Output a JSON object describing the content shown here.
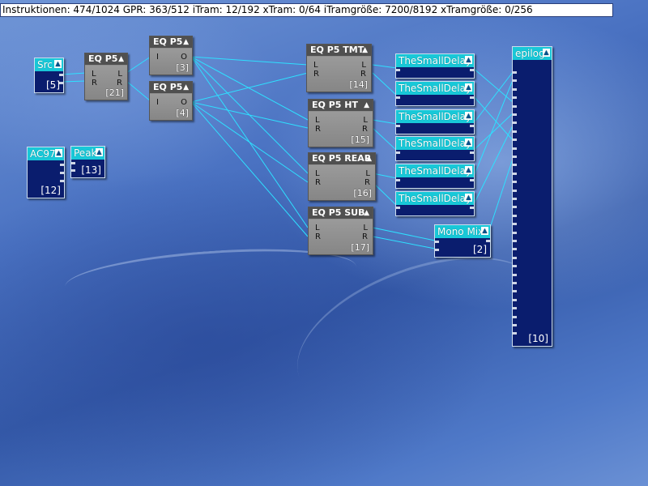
{
  "status_bar": "Instruktionen: 474/1024 GPR: 363/512 iTram: 12/192 xTram: 0/64 iTramgröße: 7200/8192 xTramgröße: 0/256",
  "arrow": "▲",
  "blocks": {
    "src": {
      "title": "Src",
      "index": "[5]"
    },
    "ac97": {
      "title": "AC97",
      "index": "[12]"
    },
    "peak": {
      "title": "Peak",
      "index": "[13]"
    },
    "eq21": {
      "title": "EQ P5",
      "index": "[21]",
      "ports_in": [
        "L",
        "R"
      ],
      "ports_out": [
        "L",
        "R"
      ]
    },
    "eq3": {
      "title": "EQ P5",
      "index": "[3]",
      "ports_in": [
        "I"
      ],
      "ports_out": [
        "O"
      ]
    },
    "eq4": {
      "title": "EQ P5",
      "index": "[4]",
      "ports_in": [
        "I"
      ],
      "ports_out": [
        "O"
      ]
    },
    "eq14": {
      "title": "EQ P5 TMT",
      "index": "[14]",
      "ports_in": [
        "L",
        "R"
      ],
      "ports_out": [
        "L",
        "R"
      ]
    },
    "eq15": {
      "title": "EQ P5 HT",
      "index": "[15]",
      "ports_in": [
        "L",
        "R"
      ],
      "ports_out": [
        "L",
        "R"
      ]
    },
    "eq16": {
      "title": "EQ P5 REAR",
      "index": "[16]",
      "ports_in": [
        "L",
        "R"
      ],
      "ports_out": [
        "L",
        "R"
      ]
    },
    "eq17": {
      "title": "EQ P5 SUB",
      "index": "[17]",
      "ports_in": [
        "L",
        "R"
      ],
      "ports_out": [
        "L",
        "R"
      ]
    },
    "delay1": {
      "title": "TheSmallDelay"
    },
    "delay2": {
      "title": "TheSmallDelay"
    },
    "delay3": {
      "title": "TheSmallDelay"
    },
    "delay4": {
      "title": "TheSmallDelay"
    },
    "delay5": {
      "title": "TheSmallDelay"
    },
    "delay6": {
      "title": "TheSmallDelay"
    },
    "monomix": {
      "title": "Mono Mix",
      "index": "[2]"
    },
    "epilog": {
      "title": "epilog",
      "index": "[10]"
    }
  },
  "colors": {
    "wire": "#2ee0ff",
    "cyan_title": "#18c8d8",
    "navy_body": "#0a1d6e",
    "gray_title": "#505050",
    "gray_body": "#8e8e8e"
  }
}
